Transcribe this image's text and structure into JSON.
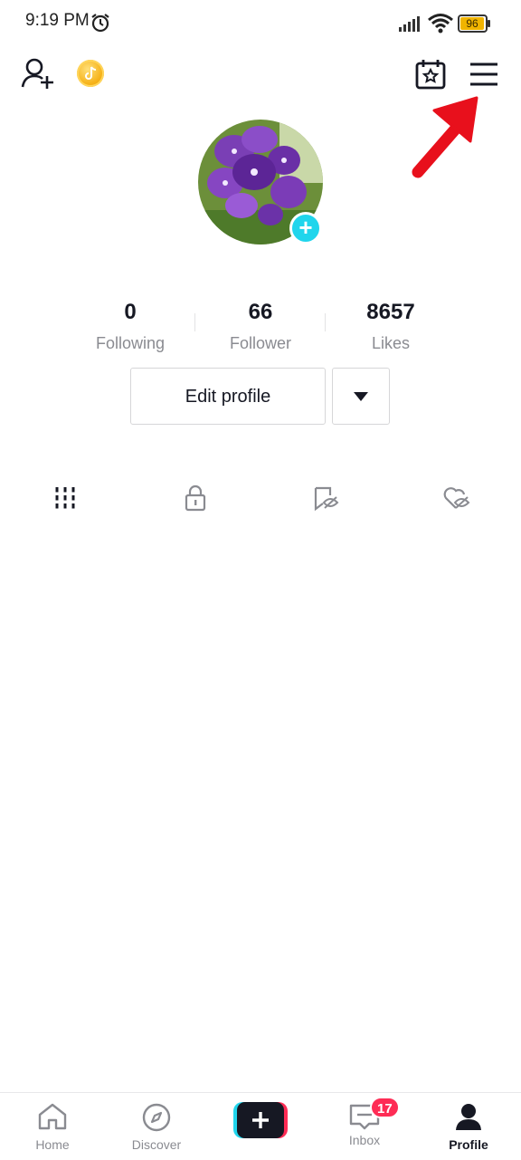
{
  "status": {
    "time": "9:19 PM",
    "battery": "96"
  },
  "profile": {
    "stats": [
      {
        "value": "0",
        "label": "Following"
      },
      {
        "value": "66",
        "label": "Follower"
      },
      {
        "value": "8657",
        "label": "Likes"
      }
    ],
    "edit_label": "Edit profile"
  },
  "nav": {
    "home": "Home",
    "discover": "Discover",
    "inbox": "Inbox",
    "inbox_badge": "17",
    "profile": "Profile"
  },
  "colors": {
    "accent": "#20d5ec",
    "badge": "#fe2c55",
    "arrow": "#e8101c",
    "coin": "#f6b31b"
  }
}
